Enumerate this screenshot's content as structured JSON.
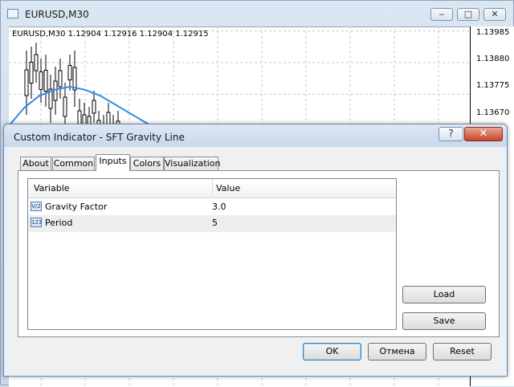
{
  "chart_window": {
    "title": "EURUSD,M30",
    "info": "EURUSD,M30  1.12904 1.12916 1.12904 1.12915",
    "price_labels": [
      "1.13985",
      "1.13880",
      "1.13775",
      "1.13670"
    ],
    "controls": {
      "minimize": "‒",
      "maximize": "□",
      "close": "✕"
    }
  },
  "chart_data": {
    "type": "line",
    "title": "EURUSD,M30",
    "xlabel": "",
    "ylabel": "",
    "ylim": [
      1.1364,
      1.14
    ],
    "grid": true,
    "series": [
      {
        "values": [
          1.1367,
          1.1373,
          1.1377,
          1.1379,
          1.138,
          1.1379,
          1.1377,
          1.1374,
          1.1371,
          1.1368,
          1.1365
        ]
      }
    ]
  },
  "dialog": {
    "title": "Custom Indicator - SFT Gravity Line",
    "help_label": "?",
    "close_label": "✕",
    "tabs": [
      {
        "label": "About"
      },
      {
        "label": "Common"
      },
      {
        "label": "Inputs"
      },
      {
        "label": "Colors"
      },
      {
        "label": "Visualization"
      }
    ],
    "active_tab": "Inputs",
    "grid": {
      "headers": {
        "variable": "Variable",
        "value": "Value"
      },
      "rows": [
        {
          "icon": "V/2",
          "variable": "Gravity Factor",
          "value": "3.0"
        },
        {
          "icon": "123",
          "variable": "Period",
          "value": "5"
        }
      ]
    },
    "buttons": {
      "load": "Load",
      "save": "Save",
      "ok": "OK",
      "cancel": "Отмена",
      "reset": "Reset"
    }
  }
}
